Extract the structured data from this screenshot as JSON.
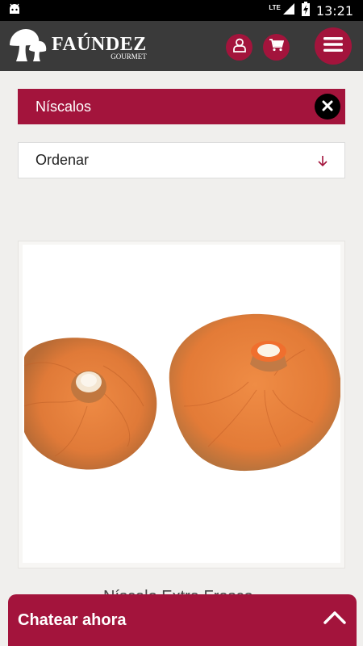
{
  "status_bar": {
    "time": "13:21",
    "network": "LTE"
  },
  "header": {
    "brand": "FAÚNDEZ",
    "sub_brand": "GOURMET"
  },
  "filter": {
    "active_label": "Níscalos"
  },
  "sort": {
    "label": "Ordenar"
  },
  "product": {
    "name": "Níscalo Extra Fresco"
  },
  "chat": {
    "label": "Chatear ahora"
  },
  "colors": {
    "accent": "#a3143c",
    "header_bg": "#3a3a3a",
    "page_bg": "#f0efed"
  }
}
